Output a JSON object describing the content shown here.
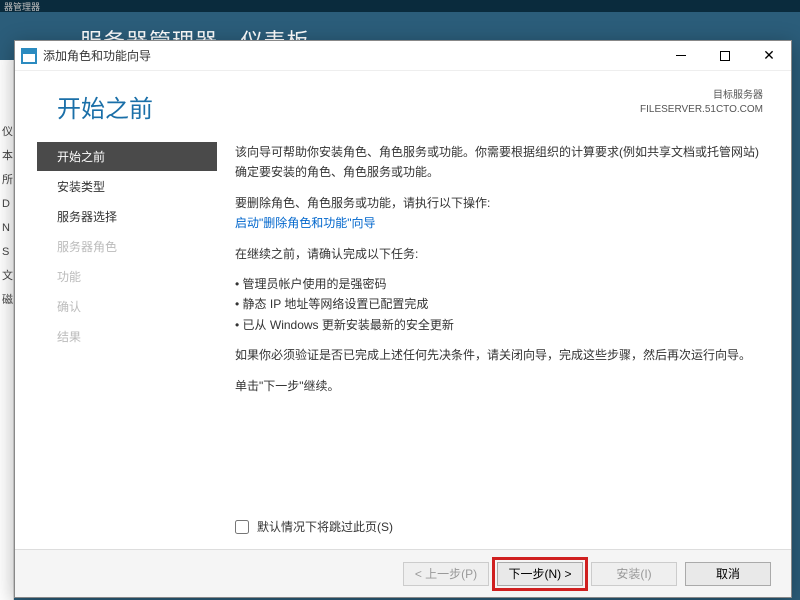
{
  "background": {
    "topbar": "器管理器",
    "title": "服务器管理器 · 仪表板",
    "left_items": [
      "仪",
      "本",
      "所",
      "D",
      "N",
      "S",
      "文",
      "磁"
    ]
  },
  "titlebar": {
    "text": "添加角色和功能向导"
  },
  "header": {
    "heading": "开始之前",
    "target_label": "目标服务器",
    "target_value": "FILESERVER.51CTO.COM"
  },
  "sidebar": {
    "steps": [
      {
        "label": "开始之前",
        "state": "active"
      },
      {
        "label": "安装类型",
        "state": "enabled"
      },
      {
        "label": "服务器选择",
        "state": "enabled"
      },
      {
        "label": "服务器角色",
        "state": "disabled"
      },
      {
        "label": "功能",
        "state": "disabled"
      },
      {
        "label": "确认",
        "state": "disabled"
      },
      {
        "label": "结果",
        "state": "disabled"
      }
    ]
  },
  "content": {
    "intro": "该向导可帮助你安装角色、角色服务或功能。你需要根据组织的计算要求(例如共享文档或托管网站)确定要安装的角色、角色服务或功能。",
    "remove_label": "要删除角色、角色服务或功能，请执行以下操作:",
    "remove_link": "启动\"删除角色和功能\"向导",
    "pre_label": "在继续之前，请确认完成以下任务:",
    "bullets": [
      "管理员帐户使用的是强密码",
      "静态 IP 地址等网络设置已配置完成",
      "已从 Windows 更新安装最新的安全更新"
    ],
    "verify": "如果你必须验证是否已完成上述任何先决条件，请关闭向导，完成这些步骤，然后再次运行向导。",
    "continue": "单击\"下一步\"继续。"
  },
  "skip": {
    "label": "默认情况下将跳过此页(S)"
  },
  "footer": {
    "prev": "< 上一步(P)",
    "next": "下一步(N) >",
    "install": "安装(I)",
    "cancel": "取消"
  }
}
